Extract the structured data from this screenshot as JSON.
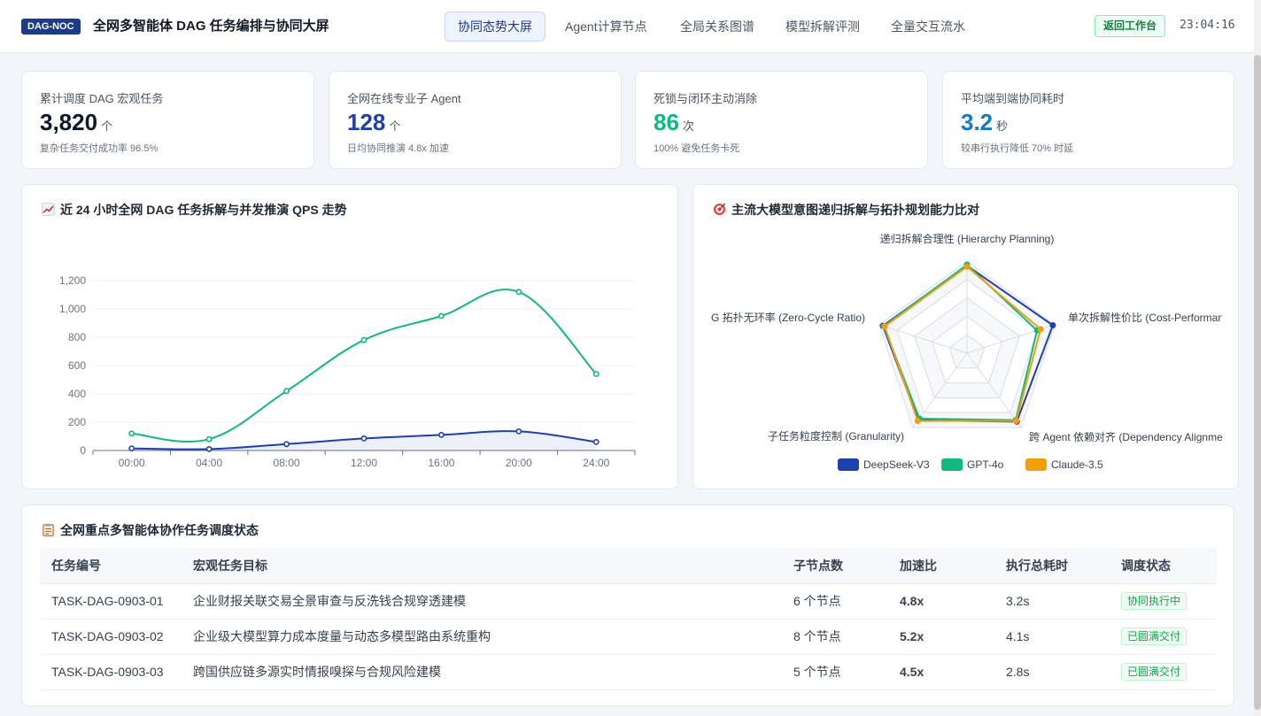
{
  "header": {
    "badge": "DAG-NOC",
    "title": "全网多智能体 DAG 任务编排与协同大屏",
    "tabs": [
      "协同态势大屏",
      "Agent计算节点",
      "全局关系图谱",
      "模型拆解评测",
      "全量交互流水"
    ],
    "active_tab": 0,
    "back_button": "返回工作台",
    "clock": "23:04:16"
  },
  "kpis": [
    {
      "label": "累计调度 DAG 宏观任务",
      "value": "3,820",
      "unit": "个",
      "note": "复杂任务交付成功率 96.5%",
      "color": "#111827"
    },
    {
      "label": "全网在线专业子 Agent",
      "value": "128",
      "unit": "个",
      "note": "日均协同推演 4.8x 加速",
      "color": "#1e40af"
    },
    {
      "label": "死锁与闭环主动消除",
      "value": "86",
      "unit": "次",
      "note": "100% 避免任务卡死",
      "color": "#10b981"
    },
    {
      "label": "平均端到端协同耗时",
      "value": "3.2",
      "unit": "秒",
      "note": "较串行执行降低 70% 时延",
      "color": "#0e7fc0"
    }
  ],
  "line_panel": {
    "title": "近 24 小时全网 DAG 任务拆解与并发推演 QPS 走势",
    "icon": "chart-increasing-icon"
  },
  "radar_panel": {
    "title": "主流大模型意图递归拆解与拓扑规划能力比对",
    "icon": "target-icon"
  },
  "table_panel": {
    "title": "全网重点多智能体协作任务调度状态",
    "icon": "clipboard-icon"
  },
  "chart_data": [
    {
      "type": "line",
      "title": "近 24 小时全网 DAG 任务拆解与并发推演 QPS 走势",
      "x": [
        "00:00",
        "04:00",
        "08:00",
        "12:00",
        "16:00",
        "20:00",
        "24:00"
      ],
      "ylim": [
        0,
        1200
      ],
      "yticks": [
        0,
        200,
        400,
        600,
        800,
        1000,
        1200
      ],
      "smooth": true,
      "grid": true,
      "series": [
        {
          "values": [
            120,
            80,
            420,
            780,
            950,
            1120,
            540
          ],
          "color": "#10b981",
          "area": false
        },
        {
          "values": [
            15,
            10,
            45,
            85,
            110,
            135,
            60
          ],
          "color": "#1e40af",
          "area": true
        }
      ]
    },
    {
      "type": "radar",
      "indicators": [
        "递归拆解合理性 (Hierarchy Planning)",
        "单次拆解性价比 (Cost-Performance)",
        "跨 Agent 依赖对齐 (Dependency Alignment)",
        "子任务粒度控制 (Granularity)",
        "DAG 拓扑无环率 (Zero-Cycle Ratio)"
      ],
      "max": 100,
      "legend_position": "bottom",
      "series": [
        {
          "name": "DeepSeek-V3",
          "values": [
            95,
            98,
            92,
            90,
            96
          ],
          "color": "#1e40af"
        },
        {
          "name": "GPT-4o",
          "values": [
            96,
            80,
            90,
            88,
            95
          ],
          "color": "#10b981"
        },
        {
          "name": "Claude-3.5",
          "values": [
            94,
            84,
            91,
            91,
            94
          ],
          "color": "#f59e0b"
        }
      ]
    }
  ],
  "table": {
    "columns": [
      "任务编号",
      "宏观任务目标",
      "子节点数",
      "加速比",
      "执行总耗时",
      "调度状态"
    ],
    "rows": [
      [
        "TASK-DAG-0903-01",
        "企业财报关联交易全景审查与反洗钱合规穿透建模",
        "6 个节点",
        "4.8x",
        "3.2s",
        "协同执行中"
      ],
      [
        "TASK-DAG-0903-02",
        "企业级大模型算力成本度量与动态多模型路由系统重构",
        "8 个节点",
        "5.2x",
        "4.1s",
        "已圆满交付"
      ],
      [
        "TASK-DAG-0903-03",
        "跨国供应链多源实时情报嗅探与合规风险建模",
        "5 个节点",
        "4.5x",
        "2.8s",
        "已圆满交付"
      ]
    ]
  }
}
